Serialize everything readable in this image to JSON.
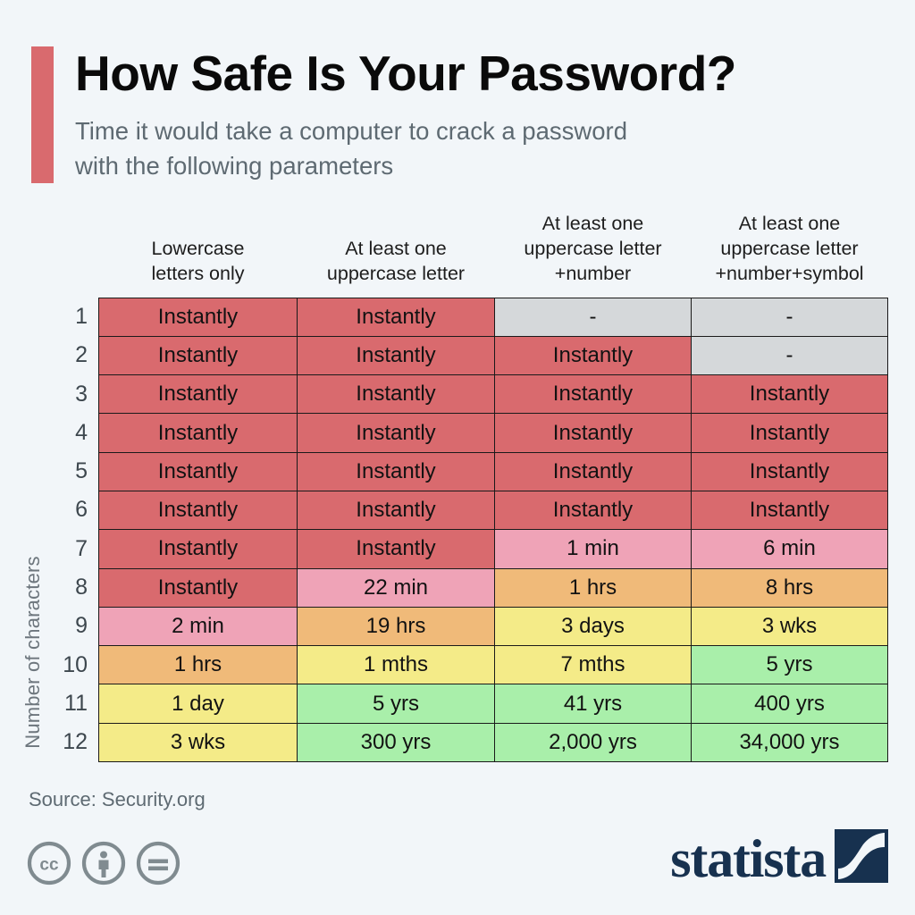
{
  "header": {
    "title": "How Safe Is Your Password?",
    "subtitle": "Time it would take a computer to crack a password with the following parameters",
    "accent_color": "#d96a6e"
  },
  "axis": {
    "y_label": "Number of characters"
  },
  "footer": {
    "source": "Source: Security.org",
    "license_icons": [
      "cc-icon",
      "cc-by-icon",
      "cc-nd-icon"
    ],
    "brand": "statista",
    "brand_color": "#17314f"
  },
  "legend_colors": {
    "red": "#d96a6e",
    "pink": "#efa3b7",
    "orange": "#f0ba79",
    "yellow": "#f4eb88",
    "green": "#a9efaa",
    "gray": "#d5d8da"
  },
  "chart_data": {
    "type": "heatmap",
    "title": "How Safe Is Your Password?",
    "subtitle": "Time it would take a computer to crack a password with the following parameters",
    "xlabel": "",
    "ylabel": "Number of characters",
    "grid": true,
    "legend_position": "none",
    "categories": [
      "Lowercase letters only",
      "At least one uppercase letter",
      "At least one uppercase letter +number",
      "At least one uppercase letter +number+symbol"
    ],
    "column_headers": [
      [
        "Lowercase",
        "letters only"
      ],
      [
        "At least one",
        "uppercase letter"
      ],
      [
        "At least one",
        "uppercase letter",
        "+number"
      ],
      [
        "At least one",
        "uppercase letter",
        "+number+symbol"
      ]
    ],
    "row_labels": [
      "1",
      "2",
      "3",
      "4",
      "5",
      "6",
      "7",
      "8",
      "9",
      "10",
      "11",
      "12"
    ],
    "rows": [
      {
        "label": "1",
        "cells": [
          {
            "value": "Instantly",
            "color": "red"
          },
          {
            "value": "Instantly",
            "color": "red"
          },
          {
            "value": "-",
            "color": "gray"
          },
          {
            "value": "-",
            "color": "gray"
          }
        ]
      },
      {
        "label": "2",
        "cells": [
          {
            "value": "Instantly",
            "color": "red"
          },
          {
            "value": "Instantly",
            "color": "red"
          },
          {
            "value": "Instantly",
            "color": "red"
          },
          {
            "value": "-",
            "color": "gray"
          }
        ]
      },
      {
        "label": "3",
        "cells": [
          {
            "value": "Instantly",
            "color": "red"
          },
          {
            "value": "Instantly",
            "color": "red"
          },
          {
            "value": "Instantly",
            "color": "red"
          },
          {
            "value": "Instantly",
            "color": "red"
          }
        ]
      },
      {
        "label": "4",
        "cells": [
          {
            "value": "Instantly",
            "color": "red"
          },
          {
            "value": "Instantly",
            "color": "red"
          },
          {
            "value": "Instantly",
            "color": "red"
          },
          {
            "value": "Instantly",
            "color": "red"
          }
        ]
      },
      {
        "label": "5",
        "cells": [
          {
            "value": "Instantly",
            "color": "red"
          },
          {
            "value": "Instantly",
            "color": "red"
          },
          {
            "value": "Instantly",
            "color": "red"
          },
          {
            "value": "Instantly",
            "color": "red"
          }
        ]
      },
      {
        "label": "6",
        "cells": [
          {
            "value": "Instantly",
            "color": "red"
          },
          {
            "value": "Instantly",
            "color": "red"
          },
          {
            "value": "Instantly",
            "color": "red"
          },
          {
            "value": "Instantly",
            "color": "red"
          }
        ]
      },
      {
        "label": "7",
        "cells": [
          {
            "value": "Instantly",
            "color": "red"
          },
          {
            "value": "Instantly",
            "color": "red"
          },
          {
            "value": "1 min",
            "color": "pink"
          },
          {
            "value": "6 min",
            "color": "pink"
          }
        ]
      },
      {
        "label": "8",
        "cells": [
          {
            "value": "Instantly",
            "color": "red"
          },
          {
            "value": "22 min",
            "color": "pink"
          },
          {
            "value": "1 hrs",
            "color": "orange"
          },
          {
            "value": "8 hrs",
            "color": "orange"
          }
        ]
      },
      {
        "label": "9",
        "cells": [
          {
            "value": "2 min",
            "color": "pink"
          },
          {
            "value": "19 hrs",
            "color": "orange"
          },
          {
            "value": "3 days",
            "color": "yellow"
          },
          {
            "value": "3 wks",
            "color": "yellow"
          }
        ]
      },
      {
        "label": "10",
        "cells": [
          {
            "value": "1 hrs",
            "color": "orange"
          },
          {
            "value": "1 mths",
            "color": "yellow"
          },
          {
            "value": "7 mths",
            "color": "yellow"
          },
          {
            "value": "5 yrs",
            "color": "green"
          }
        ]
      },
      {
        "label": "11",
        "cells": [
          {
            "value": "1 day",
            "color": "yellow"
          },
          {
            "value": "5 yrs",
            "color": "green"
          },
          {
            "value": "41 yrs",
            "color": "green"
          },
          {
            "value": "400 yrs",
            "color": "green"
          }
        ]
      },
      {
        "label": "12",
        "cells": [
          {
            "value": "3 wks",
            "color": "yellow"
          },
          {
            "value": "300 yrs",
            "color": "green"
          },
          {
            "value": "2,000 yrs",
            "color": "green"
          },
          {
            "value": "34,000 yrs",
            "color": "green"
          }
        ]
      }
    ]
  }
}
